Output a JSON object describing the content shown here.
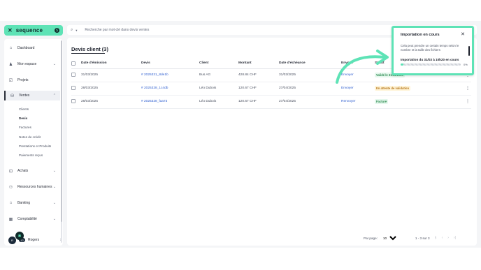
{
  "app": {
    "logo_text": "sequence",
    "logo_badge": "$"
  },
  "sidebar": {
    "items": [
      {
        "label": "Dashboard",
        "icon": "home-icon"
      },
      {
        "label": "Mon espace",
        "icon": "person-icon"
      },
      {
        "label": "Projets",
        "icon": "check-square-icon"
      },
      {
        "label": "Ventes",
        "icon": "bag-icon"
      },
      {
        "label": "Achats",
        "icon": "cart-icon"
      },
      {
        "label": "Ressources humaines",
        "icon": "people-icon"
      },
      {
        "label": "Banking",
        "icon": "bank-icon"
      },
      {
        "label": "Comptabilité",
        "icon": "calculator-icon"
      }
    ],
    "sub_items": [
      "Clients",
      "Devis",
      "Factures",
      "Notes de crédit",
      "Prestations et Produits",
      "Paiements reçus"
    ],
    "user": {
      "name": "Rogers",
      "badge": "12"
    }
  },
  "search": {
    "placeholder": "Recherche par mot-clé dans devis ventes"
  },
  "main": {
    "title": "Devis client (3)",
    "columns": [
      "Date d'émission",
      "Devis",
      "Client",
      "Montant",
      "Date d'échéance",
      "Envoyé",
      "Statut"
    ],
    "rows": [
      {
        "date": "31/03/2025",
        "devis": "# 2025331_8de1b",
        "client": "Bus AG",
        "montant": "428.84 CHF",
        "echeance": "31/03/2025",
        "envoye": "Envoyer",
        "statut": "Validé le 31/03/2025",
        "statut_bg": "#e4f7ec",
        "statut_fg": "#2b8a4f"
      },
      {
        "date": "28/03/2025",
        "devis": "# 2025328_1c4db",
        "client": "Léo Dubois",
        "montant": "120.67 CHF",
        "echeance": "27/04/2025",
        "envoye": "Envoyer",
        "statut": "En attente de validation",
        "statut_bg": "#fff3d6",
        "statut_fg": "#b7791f"
      },
      {
        "date": "28/03/2025",
        "devis": "# 2025328_faa73",
        "client": "Léo Dubois",
        "montant": "120.67 CHF",
        "echeance": "27/04/2025",
        "envoye": "Renvoyer",
        "statut": "Facturé",
        "statut_bg": "#e4f7ec",
        "statut_fg": "#2b8a4f"
      }
    ]
  },
  "pagination": {
    "label": "Par page:",
    "per_page": "10",
    "range": "1 - 3 sur 3"
  },
  "popup": {
    "title": "Importation en cours",
    "description": "Cela peut prendre un certain temps selon le nombre et la taille des fichiers",
    "status": "Importation du 31/03 à 10h20 en cours",
    "progress_pct_label": "0%",
    "progress_value": 0.05
  },
  "colors": {
    "accent": "#5ee3b6",
    "link": "#2f5fd0"
  }
}
